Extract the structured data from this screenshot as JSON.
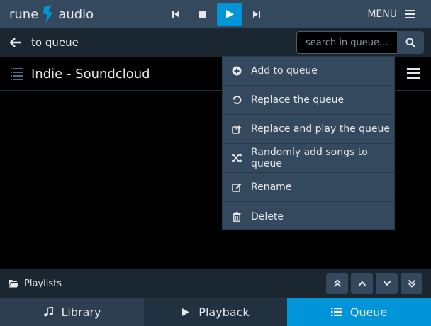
{
  "brand": {
    "left": "rune",
    "right": "audio"
  },
  "transport": {
    "prev": "previous-icon",
    "stop": "stop-icon",
    "play": "play-icon",
    "next": "next-icon"
  },
  "menu": {
    "label": "MENU"
  },
  "subbar": {
    "back_label": "to queue",
    "search_placeholder": "search in queue..."
  },
  "playlist": {
    "title": "Indie - Soundcloud"
  },
  "context_menu": {
    "items": [
      {
        "label": "Add to queue",
        "icon": "plus-circle-icon"
      },
      {
        "label": "Replace the queue",
        "icon": "undo-icon"
      },
      {
        "label": "Replace and play the queue",
        "icon": "share-icon"
      },
      {
        "label": "Randomly add songs to queue",
        "icon": "random-icon"
      },
      {
        "label": "Rename",
        "icon": "edit-icon"
      },
      {
        "label": "Delete",
        "icon": "trash-icon"
      }
    ]
  },
  "breadcrumb": {
    "label": "Playlists"
  },
  "footer": {
    "tabs": [
      {
        "label": "Library",
        "icon": "music-icon"
      },
      {
        "label": "Playback",
        "icon": "play-icon"
      },
      {
        "label": "Queue",
        "icon": "list-icon"
      }
    ],
    "active": "Queue"
  },
  "colors": {
    "topbar": "#34495e",
    "subbar": "#1a2630",
    "accent": "#0095d8",
    "menu_bg": "#34495e"
  }
}
